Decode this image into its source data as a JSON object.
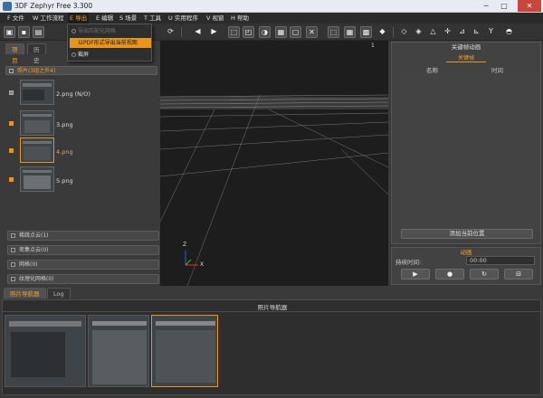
{
  "window": {
    "title": "3DF Zephyr Free 3.300",
    "minimize": "─",
    "maximize": "□",
    "close": "✕"
  },
  "menu": {
    "items": [
      "F 文件",
      "W 工作流程",
      "E 导出",
      "E 编辑",
      "S 场景",
      "T 工具",
      "U 实用程序",
      "V 视窗",
      "H 帮助"
    ],
    "active": "E 导出"
  },
  "export_menu": {
    "items": [
      {
        "label": "导出匹配化网格",
        "enabled": false,
        "icon": "mesh-icon"
      },
      {
        "label": "以PDF形式导出当前视图",
        "enabled": true,
        "highlighted": true
      },
      {
        "label": "截屏",
        "enabled": true,
        "icon": "camera-icon"
      }
    ]
  },
  "left_panel": {
    "tabs": [
      "项目",
      "历史"
    ],
    "active_tab": "项目",
    "photo_group_label": "照片(3组之外4)",
    "photos": [
      {
        "name": "2.png (N/O)",
        "checked": false,
        "selected": false
      },
      {
        "name": "3.png",
        "checked": true,
        "selected": false
      },
      {
        "name": "4.png",
        "checked": true,
        "selected": true
      },
      {
        "name": "5.png",
        "checked": true,
        "selected": false
      }
    ],
    "groups": [
      {
        "label": "稀疏点云(1)"
      },
      {
        "label": "密集点云(0)"
      },
      {
        "label": "网格(0)"
      },
      {
        "label": "纹理化网格(0)"
      }
    ]
  },
  "viewport": {
    "marker": "1",
    "axis_x": "X",
    "axis_z": "Z"
  },
  "keyframe_panel": {
    "title": "关键帧动画",
    "section": "关键帧",
    "col_name": "名称",
    "col_time": "时间",
    "add_button": "添加当前位置"
  },
  "animation_panel": {
    "title": "动画",
    "duration_label": "持续时间:",
    "duration_value": "00:00",
    "play": "▶",
    "record": "●",
    "loop": "↻",
    "save": "⊟"
  },
  "bottom": {
    "tabs": [
      "照片导航器",
      "Log"
    ],
    "active_tab": "照片导航器",
    "title": "照片导航器"
  },
  "colors": {
    "accent": "#e8951e",
    "background": "#3a3a3a",
    "viewport": "#1d1d1d"
  }
}
